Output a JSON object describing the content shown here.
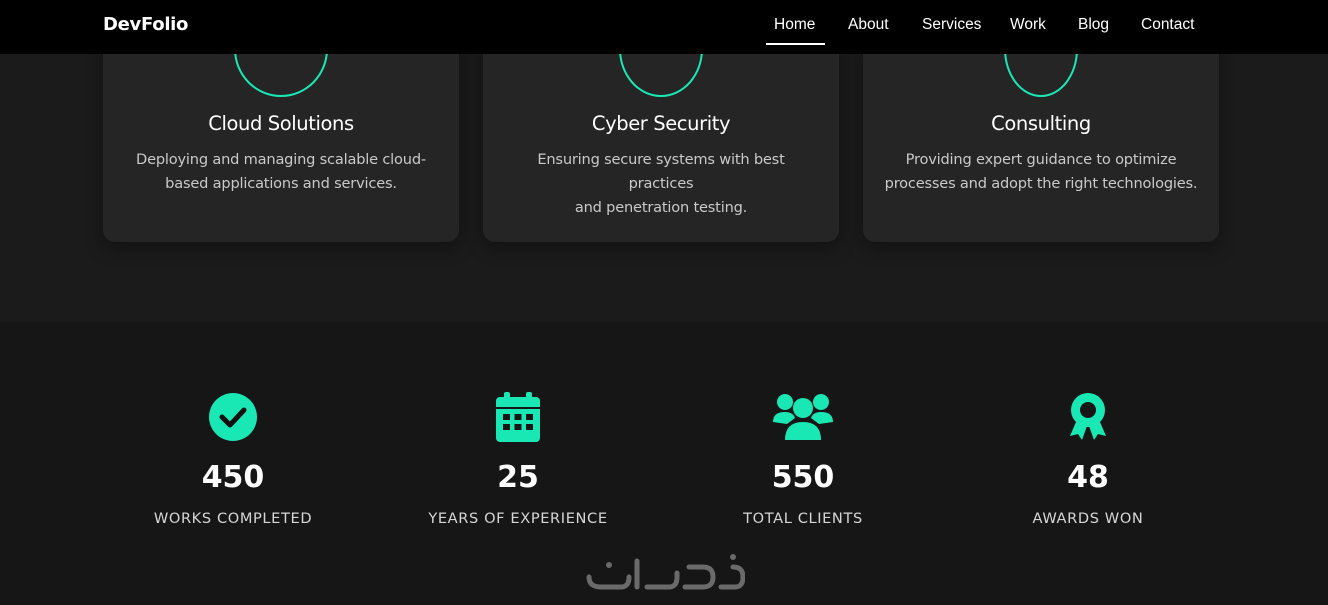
{
  "colors": {
    "accent": "#19e8b4",
    "nav_bg": "#000000",
    "page_bg": "#1c1c1c",
    "card_bg": "#252525",
    "stats_bg": "#161616"
  },
  "navbar": {
    "brand": "DevFolio",
    "links": [
      "Home",
      "About",
      "Services",
      "Work",
      "Blog",
      "Contact"
    ],
    "active": "Home"
  },
  "services": [
    {
      "title": "Cloud Solutions",
      "desc_line1": "Deploying and managing scalable cloud-",
      "desc_line2": "based applications and services.",
      "icon": "cloud-icon"
    },
    {
      "title": "Cyber Security",
      "desc_line1": "Ensuring secure systems with best practices",
      "desc_line2": "and penetration testing.",
      "icon": "shield-icon"
    },
    {
      "title": "Consulting",
      "desc_line1": "Providing expert guidance to optimize",
      "desc_line2": "processes and adopt the right technologies.",
      "icon": "lightbulb-icon"
    }
  ],
  "stats": [
    {
      "number": "450",
      "label": "WORKS COMPLETED",
      "icon": "check-circle-icon"
    },
    {
      "number": "25",
      "label": "YEARS OF EXPERIENCE",
      "icon": "calendar-icon"
    },
    {
      "number": "550",
      "label": "TOTAL CLIENTS",
      "icon": "users-icon"
    },
    {
      "number": "48",
      "label": "AWARDS WON",
      "icon": "award-icon"
    }
  ]
}
